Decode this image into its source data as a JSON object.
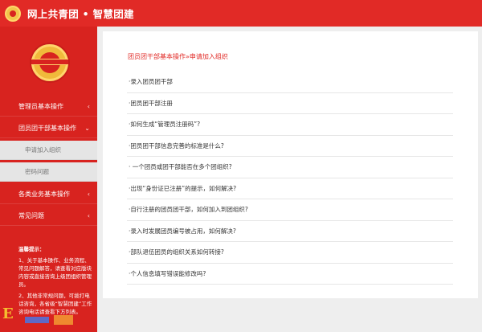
{
  "header": {
    "title": "网上共青团 • 智慧团建"
  },
  "sidebar": {
    "menu": [
      {
        "label": "管理员基本操作",
        "chevron": "‹"
      },
      {
        "label": "团员团干部基本操作",
        "chevron": "⌄"
      },
      {
        "label": "各类业务基本操作",
        "chevron": "‹"
      },
      {
        "label": "常见问题",
        "chevron": "‹"
      }
    ],
    "submenu": [
      {
        "label": "申请加入组织"
      },
      {
        "label": "密码问题"
      }
    ],
    "tips": {
      "title": "温馨提示：",
      "items": [
        "1、关于基本操作、业务流程、常见问题解答，请查看对应版块内容或直接咨询上级团组织管理员。",
        "2、其他非常规问题，可拨打电话咨询，各省级“智慧团建”工作咨询电话请查看下方列表。"
      ]
    }
  },
  "main": {
    "breadcrumb": "团员团干部基本操作»申请加入组织",
    "questions": [
      "·录入团员团干部",
      "·团员团干部注册",
      "·如何生成“管理员注册码”?",
      "·团员团干部信息完善的标准是什么?",
      "· 一个团员或团干部能否在多个团组织?",
      "·出现“身份证已注册”的提示，如何解决?",
      "·自行注册的团员团干部，如何加入到团组织?",
      "·录入时发展团员编号被占用，如何解决?",
      "·部队退伍团员的组织关系如何转接?",
      "·个人信息填写错误能修改吗?"
    ]
  },
  "colors": {
    "brand_red": "#e12a26",
    "sidebar_red": "#d8231f",
    "submenu_bg": "#e5e5e5",
    "accent_gold": "#f0b93b"
  },
  "icons": {
    "header_logo": "youth-league-emblem-icon",
    "sidebar_badge": "youth-league-emblem-icon",
    "menu_chevron": "chevron-left-icon",
    "menu_open_chevron": "chevron-down-icon"
  }
}
